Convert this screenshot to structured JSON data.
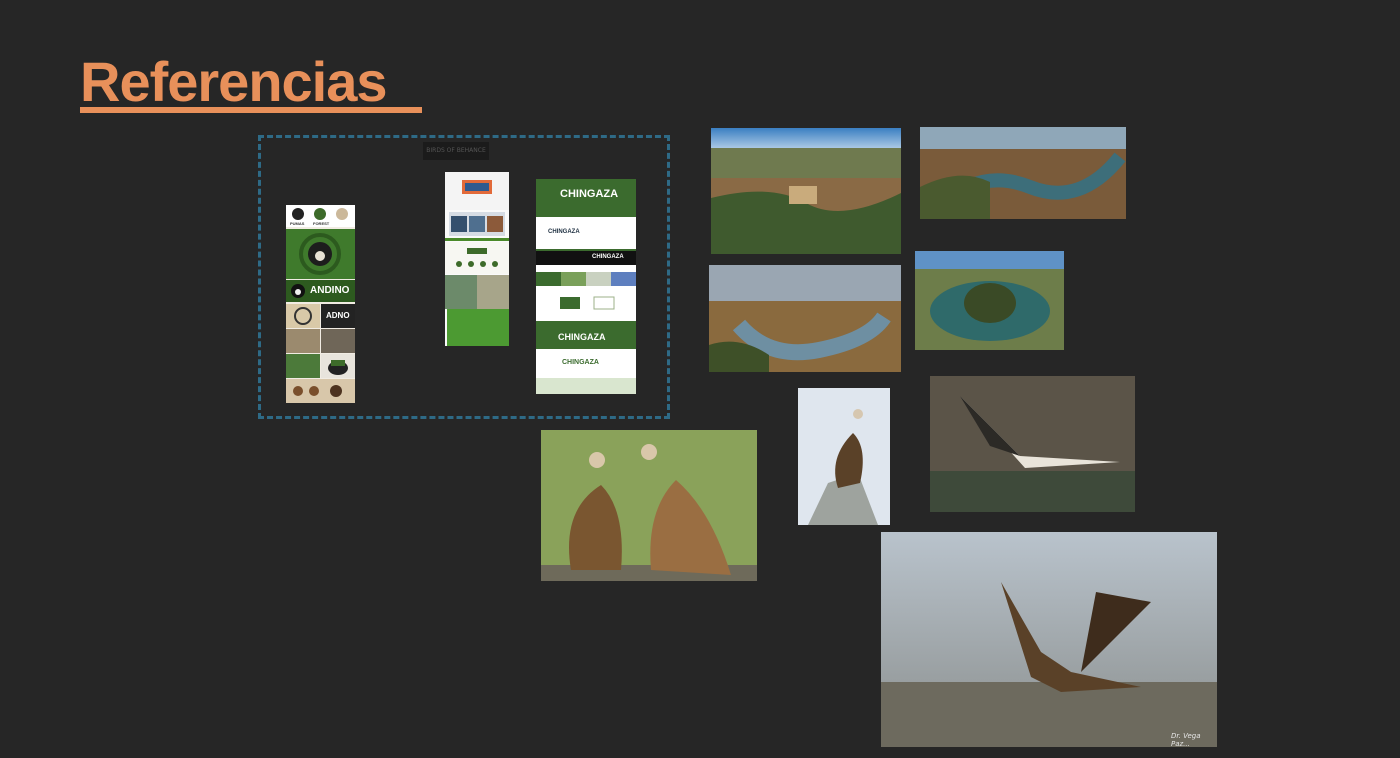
{
  "slide": {
    "title": "Referencias",
    "background": "#262626",
    "accent": "#e8905a"
  },
  "group": {
    "label": "BIRDS OF BEHANCE",
    "frame_color": "#2e6a86"
  },
  "boards": {
    "andino": {
      "labels": [
        "PUMAS",
        "FOREST",
        "ANDINO",
        "ADNO"
      ]
    },
    "birds": {
      "title": "BIRDS OF BEHANCE"
    },
    "chingaza": {
      "title": "CHINGAZA",
      "items": [
        "CHINGAZA",
        "CHINGAZA",
        "CHINGAZA",
        "CHINGAZA"
      ]
    }
  },
  "photos": {
    "watermark": "Dr. Vega Paz..."
  }
}
